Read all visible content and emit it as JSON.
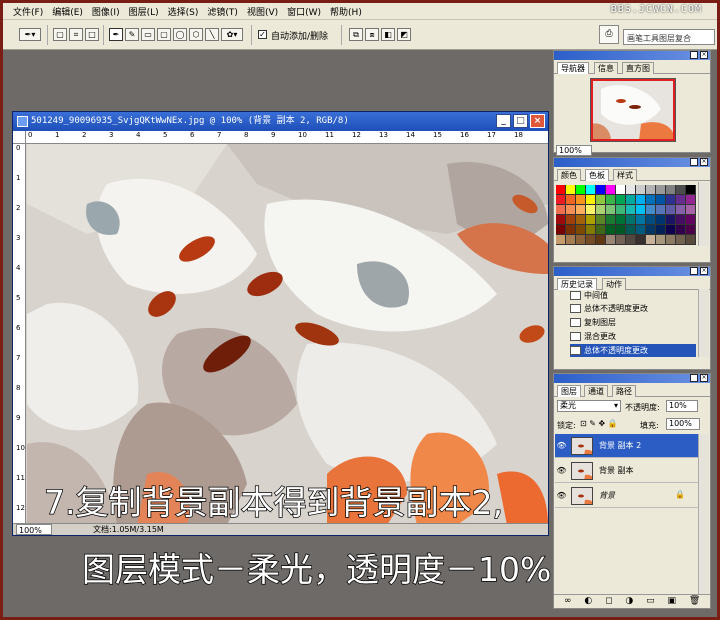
{
  "menu": [
    "文件(F)",
    "编辑(E)",
    "图像(I)",
    "图层(L)",
    "选择(S)",
    "滤镜(T)",
    "视图(V)",
    "窗口(W)",
    "帮助(H)"
  ],
  "watermark": "BBS.JCWCN.COM",
  "options_bar": {
    "auto_add_delete_label": "自动添加/删除",
    "auto_add_delete_checked": "✓",
    "well_text": "画笔工具图层复合"
  },
  "document": {
    "title": "501249_90096935_SvjgQKtWwNEx.jpg @ 100% (背景 副本 2, RGB/8)",
    "zoom": "100%",
    "doc_info": "文档:1.05M/3.15M",
    "ruler_top": [
      "0",
      "1",
      "2",
      "3",
      "4",
      "5",
      "6",
      "7",
      "8",
      "9",
      "10",
      "11",
      "12",
      "13",
      "14",
      "15",
      "16",
      "17",
      "18"
    ],
    "ruler_left": [
      "0",
      "1",
      "2",
      "3",
      "4",
      "5",
      "6",
      "7",
      "8",
      "9",
      "10",
      "11",
      "12"
    ]
  },
  "caption": {
    "line1": "7.复制背景副本得到背景副本2,",
    "line2": "图层模式－柔光，透明度－10%"
  },
  "navigator": {
    "tabs": [
      "导航器",
      "信息",
      "直方图"
    ],
    "zoom": "100%"
  },
  "color_panel": {
    "tabs": [
      "颜色",
      "色板",
      "样式"
    ],
    "swatch_colors": [
      "#ff0000",
      "#ffff00",
      "#00ff00",
      "#00ffff",
      "#0000ff",
      "#ff00ff",
      "#ffffff",
      "#e6e6e6",
      "#cccccc",
      "#b3b3b3",
      "#999999",
      "#808080",
      "#4d4d4d",
      "#000000",
      "#ed1c24",
      "#f26522",
      "#f7941d",
      "#fff200",
      "#8dc63f",
      "#39b54a",
      "#00a651",
      "#00a99d",
      "#00aeef",
      "#0072bc",
      "#0054a6",
      "#2e3192",
      "#662d91",
      "#92278f",
      "#f26c4f",
      "#f68e55",
      "#fbaf5c",
      "#fff467",
      "#acd372",
      "#7cc576",
      "#3bb878",
      "#1abbb4",
      "#00bff3",
      "#438ccb",
      "#5574b9",
      "#605ca8",
      "#855fa8",
      "#a763a8",
      "#9e0b0f",
      "#a0410d",
      "#a36209",
      "#aba000",
      "#598527",
      "#1a7b30",
      "#007236",
      "#00746b",
      "#0076a3",
      "#004b80",
      "#003471",
      "#1b1464",
      "#440e62",
      "#630460",
      "#790000",
      "#7b2e00",
      "#7d4900",
      "#827b00",
      "#406618",
      "#005e20",
      "#005826",
      "#005952",
      "#005b7f",
      "#003663",
      "#002157",
      "#0d004c",
      "#32004b",
      "#4b0049",
      "#c69c6d",
      "#a67c52",
      "#8c6239",
      "#754c24",
      "#603913",
      "#998675",
      "#736357",
      "#534741",
      "#362f2d",
      "#c7b299",
      "#a6977c",
      "#8c7b64",
      "#736250",
      "#594a3c"
    ]
  },
  "history_panel": {
    "tabs": [
      "历史记录",
      "动作"
    ],
    "items": [
      "中间值",
      "总体不透明度更改",
      "复制图层",
      "混合更改",
      "总体不透明度更改"
    ]
  },
  "layers_panel": {
    "tabs": [
      "图层",
      "通道",
      "路径"
    ],
    "blend_mode": "柔光",
    "opacity_label": "不透明度:",
    "opacity_value": "10%",
    "lock_label": "锁定:",
    "fill_label": "填充:",
    "fill_value": "100%",
    "layers": [
      {
        "name": "背景 副本 2",
        "selected": true
      },
      {
        "name": "背景 副本",
        "selected": false
      },
      {
        "name": "背景",
        "selected": false
      }
    ]
  }
}
